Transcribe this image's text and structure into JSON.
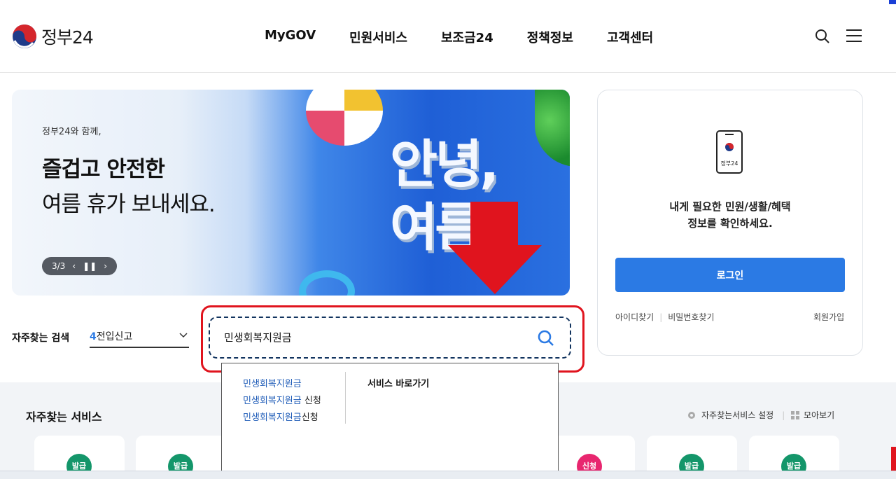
{
  "header": {
    "logo_text": "정부24",
    "nav": [
      "MyGOV",
      "민원서비스",
      "보조금24",
      "정책정보",
      "고객센터"
    ]
  },
  "banner": {
    "subtitle": "정부24와 함께,",
    "title_line1": "즐겁고 안전한",
    "title_line2": "여름 휴가 보내세요.",
    "pager_text": "3/3",
    "pool_text_1": "안녕,",
    "pool_text_2": "여름"
  },
  "login": {
    "app_label": "정부24",
    "message_line1": "내게 필요한 민원/생활/혜택",
    "message_line2": "정보를 확인하세요.",
    "login_button": "로그인",
    "find_id": "아이디찾기",
    "find_password": "비밀번호찾기",
    "join": "회원가입"
  },
  "search": {
    "popular_label": "자주찾는 검색",
    "popular_rank": "4",
    "popular_term": "전입신고",
    "query": "민생회복지원금"
  },
  "autocomplete": {
    "items": [
      {
        "match": "민생회복지원금",
        "rest": ""
      },
      {
        "match": "민생회복지원금",
        "rest": " 신청"
      },
      {
        "match": "민생회복지원금",
        "rest": "신청"
      }
    ],
    "shortcut_label": "서비스 바로가기"
  },
  "frequent_services": {
    "title": "자주찾는 서비스",
    "settings_label": "자주찾는서비스 설정",
    "view_all_label": "모아보기",
    "badges": [
      "발급",
      "발급",
      "신청",
      "발급",
      "발급"
    ]
  },
  "colors": {
    "primary": "#2b7ae4",
    "highlight_red": "#e0141e",
    "badge_green": "#14966a",
    "badge_pink": "#e8266f"
  }
}
